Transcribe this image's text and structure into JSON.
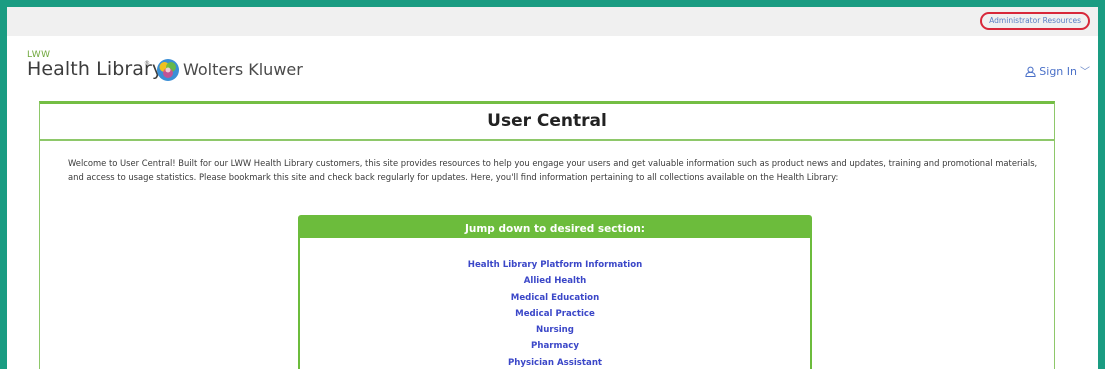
{
  "topbar": {
    "admin_link": "Administrator Resources"
  },
  "header": {
    "logo_small": "LWW",
    "logo_main": "Health Library",
    "logo_reg": "®",
    "brand_name": "Wolters Kluwer",
    "signin_label": "Sign In"
  },
  "main": {
    "title": "User Central",
    "intro": "Welcome to User Central! Built for our LWW Health Library customers, this site provides resources to help you engage your users and get valuable information such as product news and updates, training and promotional materials, and access to usage statistics. Please bookmark this site and check back regularly for updates. Here, you'll find information pertaining to all collections available on the Health Library:",
    "jump": {
      "title": "Jump down to desired section:",
      "links": [
        "Health Library Platform Information",
        "Allied Health",
        "Medical Education",
        "Medical Practice",
        "Nursing",
        "Pharmacy",
        "Physician Assistant"
      ]
    }
  },
  "colors": {
    "frame": "#1a9c82",
    "accent_green": "#6cbc3c",
    "link_blue": "#3b47c8",
    "highlight_red": "#d8283a"
  },
  "icons": [
    "wolters-kluwer-logo-icon",
    "user-icon",
    "chevron-down-icon"
  ]
}
